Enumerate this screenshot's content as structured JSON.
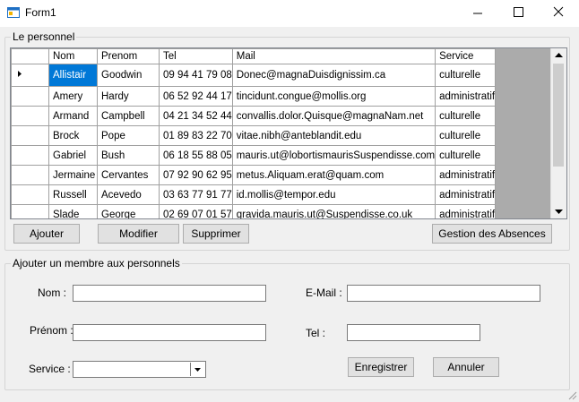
{
  "window": {
    "title": "Form1"
  },
  "personnel": {
    "group_title": "Le personnel",
    "columns": [
      "Nom",
      "Prenom",
      "Tel",
      "Mail",
      "Service"
    ],
    "rows": [
      [
        "Allistair",
        "Goodwin",
        "09 94 41 79 08",
        "Donec@magnaDuisdignissim.ca",
        "culturelle"
      ],
      [
        "Amery",
        "Hardy",
        "06 52 92 44 17",
        "tincidunt.congue@mollis.org",
        "administratif"
      ],
      [
        "Armand",
        "Campbell",
        "04 21 34 52 44",
        "convallis.dolor.Quisque@magnaNam.net",
        "culturelle"
      ],
      [
        "Brock",
        "Pope",
        "01 89 83 22 70",
        "vitae.nibh@anteblandit.edu",
        "culturelle"
      ],
      [
        "Gabriel",
        "Bush",
        "06 18 55 88 05",
        "mauris.ut@lobortismaurisSuspendisse.com",
        "culturelle"
      ],
      [
        "Jermaine",
        "Cervantes",
        "07 92 90 62 95",
        "metus.Aliquam.erat@quam.com",
        "administratif"
      ],
      [
        "Russell",
        "Acevedo",
        "03 63 77 91 77",
        "id.mollis@tempor.edu",
        "administratif"
      ],
      [
        "Slade",
        "George",
        "02 69 07 01 57",
        "gravida.mauris.ut@Suspendisse.co.uk",
        "administratif"
      ]
    ],
    "buttons": {
      "add": "Ajouter",
      "edit": "Modifier",
      "delete": "Supprimer",
      "absences": "Gestion des Absences"
    }
  },
  "form": {
    "group_title": "Ajouter un membre aux personnels",
    "nom_label": "Nom :",
    "prenom_label": "Prénom :",
    "service_label": "Service :",
    "email_label": "E-Mail :",
    "tel_label": "Tel :",
    "nom_value": "",
    "prenom_value": "",
    "email_value": "",
    "tel_value": "",
    "service_value": "",
    "save_label": "Enregistrer",
    "cancel_label": "Annuler"
  },
  "colors": {
    "selection": "#0078d7",
    "grid_background": "#ababab"
  },
  "icons": {
    "app": "form-icon",
    "minimize": "minimize-icon",
    "maximize": "maximize-icon",
    "close": "close-icon"
  }
}
